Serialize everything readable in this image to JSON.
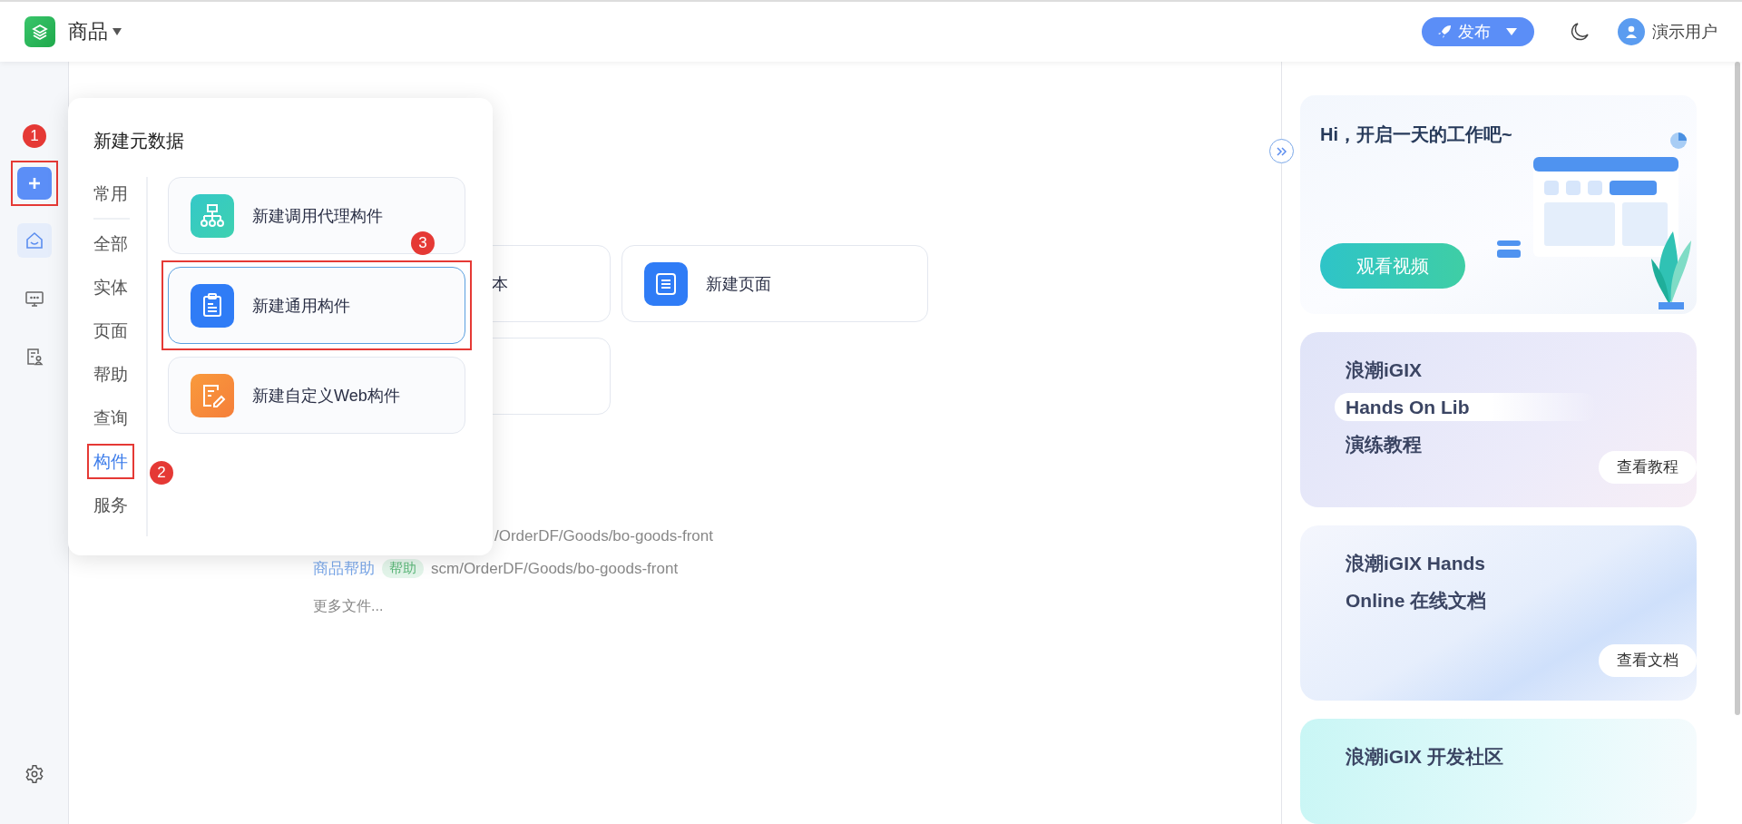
{
  "header": {
    "app_name": "商品",
    "publish": "发布",
    "user": "演示用户"
  },
  "sidebar": {
    "add_button": {
      "framed": true
    },
    "nav": [
      {
        "kind": "home",
        "selected": true
      },
      {
        "kind": "monitor",
        "selected": false
      },
      {
        "kind": "report",
        "selected": false
      }
    ]
  },
  "main": {
    "cards": [
      {
        "kind": "plain",
        "label": "本"
      },
      {
        "kind": "page",
        "label": "新建页面"
      },
      {
        "kind": "blank"
      }
    ],
    "recent": [
      {
        "path": "/OrderDF/Goods/bo-goods-front"
      },
      {
        "name": "商品帮助",
        "tag": "帮助",
        "path": "scm/OrderDF/Goods/bo-goods-front"
      }
    ],
    "more": "更多文件..."
  },
  "popup": {
    "title": "新建元数据",
    "categories": [
      {
        "label": "常用",
        "selected": false,
        "framed": false
      },
      {
        "label": "全部",
        "selected": false,
        "framed": false
      },
      {
        "label": "实体",
        "selected": false,
        "framed": false
      },
      {
        "label": "页面",
        "selected": false,
        "framed": false
      },
      {
        "label": "帮助",
        "selected": false,
        "framed": false
      },
      {
        "label": "查询",
        "selected": false,
        "framed": false
      },
      {
        "label": "构件",
        "selected": true,
        "framed": true
      },
      {
        "label": "服务",
        "selected": false,
        "framed": false
      }
    ],
    "items": [
      {
        "kind": "proxy",
        "label": "新建调用代理构件",
        "selected": false,
        "framed": false
      },
      {
        "kind": "common",
        "label": "新建通用构件",
        "selected": true,
        "framed": true
      },
      {
        "kind": "web",
        "label": "新建自定义Web构件",
        "selected": false,
        "framed": false
      }
    ]
  },
  "right_panel": {
    "greeting": "Hi，开启一天的工作吧~",
    "video_button": "观看视频",
    "cards": [
      {
        "kind": "lab",
        "lines": [
          {
            "text": "浪潮iGIX",
            "highlighted": false
          },
          {
            "text": "Hands On Lib",
            "highlighted": true
          },
          {
            "text": "演练教程",
            "highlighted": false
          }
        ],
        "button": "查看教程"
      },
      {
        "kind": "docs",
        "lines": [
          {
            "text": "浪潮iGIX Hands",
            "highlighted": false
          },
          {
            "text": "Online 在线文档",
            "highlighted": false
          }
        ],
        "button": "查看文档"
      },
      {
        "kind": "community",
        "lines": [
          {
            "text": "浪潮iGIX 开发社区",
            "highlighted": false
          }
        ]
      }
    ]
  },
  "annotations": [
    {
      "number": "1"
    },
    {
      "number": "2"
    },
    {
      "number": "3"
    }
  ]
}
